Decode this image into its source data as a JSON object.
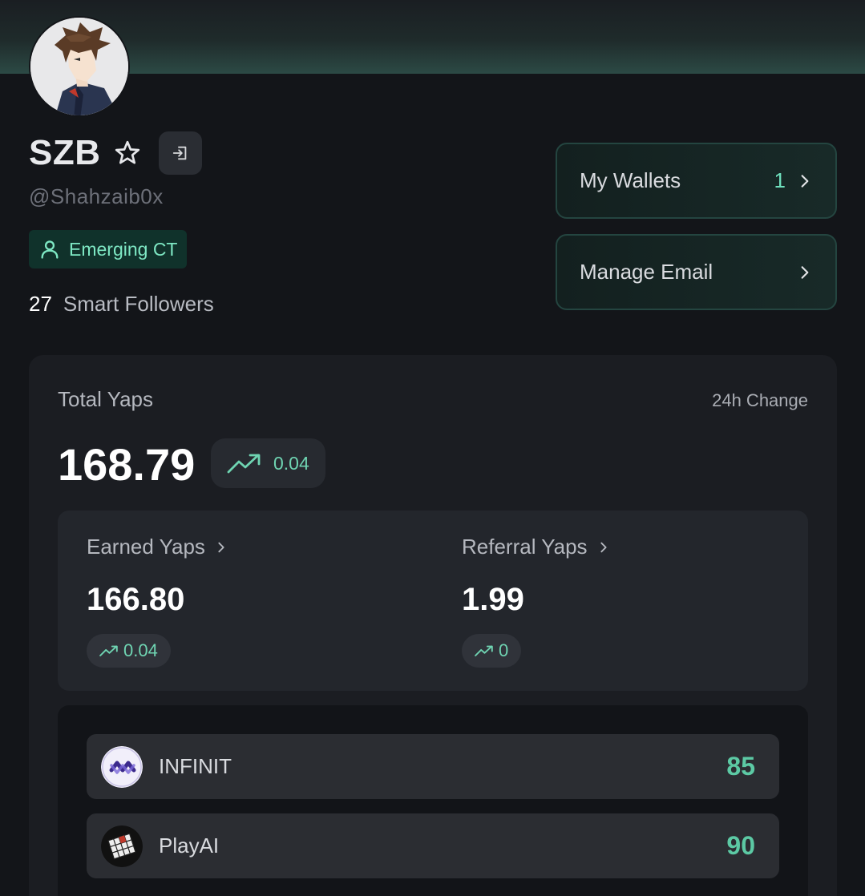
{
  "profile": {
    "name": "SZB",
    "handle": "@Shahzaib0x",
    "tag": "Emerging CT",
    "followers_count": "27",
    "followers_label": "Smart Followers"
  },
  "side_buttons": {
    "wallets_label": "My Wallets",
    "wallets_count": "1",
    "email_label": "Manage Email"
  },
  "yaps": {
    "total_label": "Total Yaps",
    "change_label": "24h Change",
    "total_value": "168.79",
    "total_delta": "0.04",
    "earned_label": "Earned Yaps",
    "earned_value": "166.80",
    "earned_delta": "0.04",
    "referral_label": "Referral Yaps",
    "referral_value": "1.99",
    "referral_delta": "0"
  },
  "projects": [
    {
      "name": "INFINIT",
      "score": "85"
    },
    {
      "name": "PlayAI",
      "score": "90"
    }
  ],
  "colors": {
    "accent": "#6fd4b2",
    "tag_bg": "#10322b",
    "background": "#131519",
    "card": "#1b1d22"
  },
  "icons": [
    "star-icon",
    "logout-icon",
    "user-icon",
    "chevron-right-icon",
    "trending-up-icon",
    "infinit-logo",
    "playai-logo"
  ]
}
